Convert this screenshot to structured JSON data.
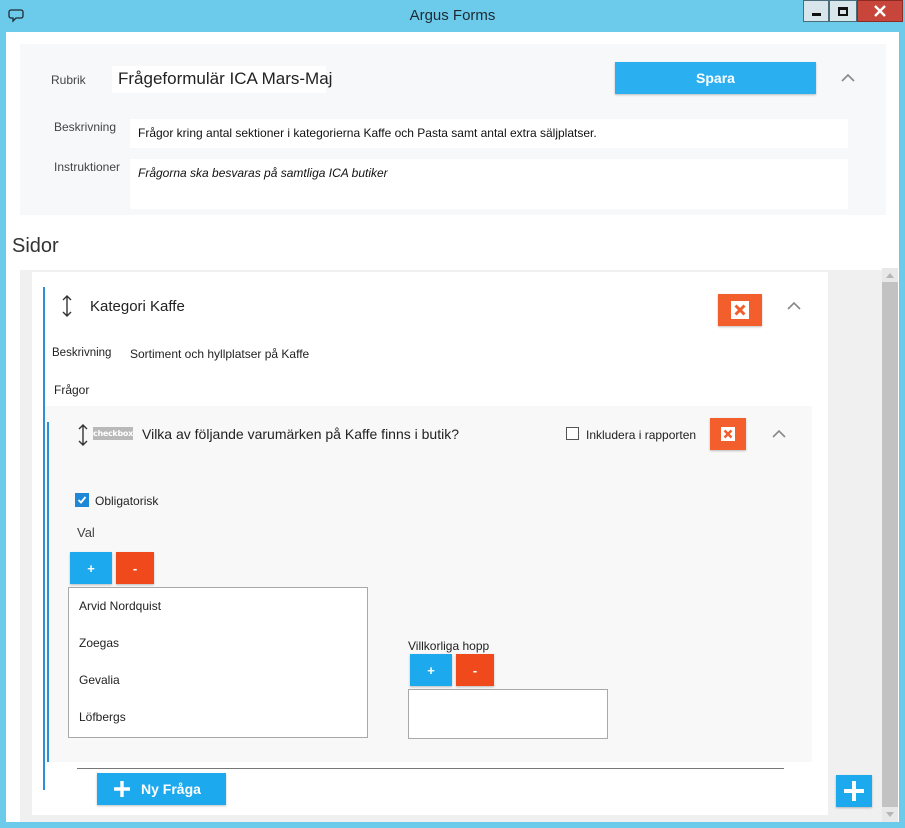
{
  "window": {
    "title": "Argus Forms",
    "icon": "speech-bubble-icon",
    "accent": "#6ccaea"
  },
  "form": {
    "rubrik_label": "Rubrik",
    "rubrik_value": "Frågeformulär ICA Mars-Maj",
    "save_label": "Spara",
    "beskrivning_label": "Beskrivning",
    "beskrivning_value": "Frågor kring antal sektioner i kategorierna Kaffe och Pasta samt antal extra säljplatser.",
    "instruktioner_label": "Instruktioner",
    "instruktioner_value": "Frågorna ska besvaras på samtliga ICA butiker"
  },
  "pages_section": {
    "title": "Sidor"
  },
  "page": {
    "title": "Kategori Kaffe",
    "beskrivning_label": "Beskrivning",
    "beskrivning_value": "Sortiment och hyllplatser på Kaffe",
    "fragor_label": "Frågor"
  },
  "question": {
    "type_badge": "checkbox",
    "text": "Vilka av följande varumärken på Kaffe finns i butik?",
    "include_report_label": "Inkludera i rapporten",
    "include_report_checked": false,
    "obligatorisk_label": "Obligatorisk",
    "obligatorisk_checked": true,
    "val_label": "Val",
    "add_label": "+",
    "remove_label": "-",
    "options": [
      "Arvid Nordquist",
      "Zoegas",
      "Gevalia",
      "Löfbergs"
    ],
    "villkorliga_label": "Villkorliga hopp"
  },
  "actions": {
    "new_question_label": "Ny Fråga"
  },
  "colors": {
    "primary": "#1da9ee",
    "danger": "#f25f2c",
    "accent_line": "#2d8fd8"
  }
}
